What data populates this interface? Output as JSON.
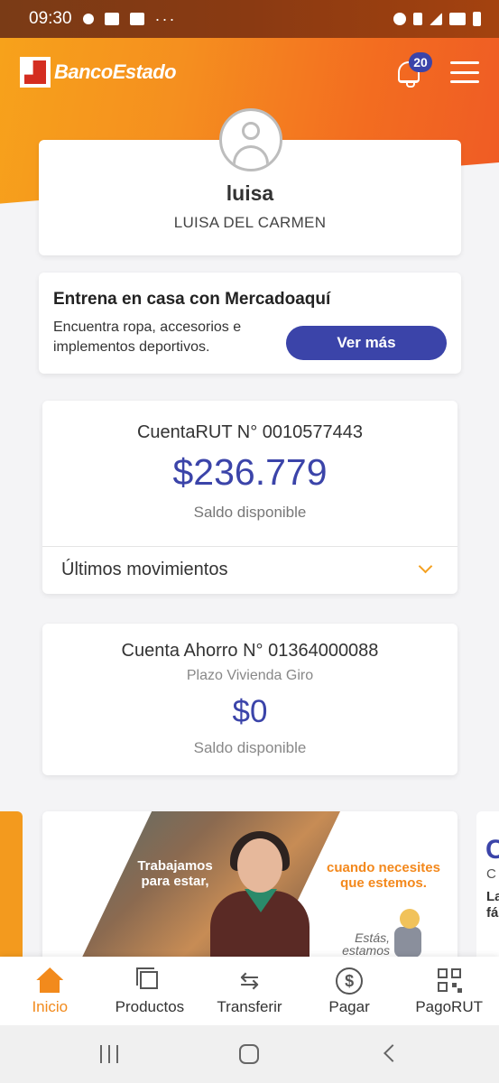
{
  "status_bar": {
    "time": "09:30",
    "left_icons": [
      "music-icon",
      "image-icon",
      "facebook-icon"
    ],
    "more": "···",
    "right_icons": [
      "alarm-icon",
      "data-icon",
      "signal-icon",
      "wifi-icon",
      "battery-icon"
    ]
  },
  "header": {
    "brand": "BancoEstado",
    "notification_count": "20"
  },
  "profile": {
    "nickname": "luisa",
    "full_name": "LUISA DEL CARMEN"
  },
  "promo": {
    "title": "Entrena en casa con Mercadoaquí",
    "description": "Encuentra ropa, accesorios e implementos deportivos.",
    "button_label": "Ver más"
  },
  "accounts": [
    {
      "name": "CuentaRUT N° 0010577443",
      "balance": "$236.779",
      "balance_label": "Saldo disponible",
      "movements_label": "Últimos movimientos"
    },
    {
      "name": "Cuenta Ahorro N° 01364000088",
      "subtitle": "Plazo Vivienda Giro",
      "balance": "$0",
      "balance_label": "Saldo disponible"
    }
  ],
  "banner": {
    "text_left": "Trabajamos para estar,",
    "text_right": "cuando necesites que estemos.",
    "text_bottom": "Estás, estamos"
  },
  "banner_next_peek": {
    "line1": "C",
    "line2": "C",
    "line3": "La fá"
  },
  "bottom_nav": {
    "items": [
      {
        "label": "Inicio",
        "icon": "home-icon",
        "active": true
      },
      {
        "label": "Productos",
        "icon": "products-icon",
        "active": false
      },
      {
        "label": "Transferir",
        "icon": "transfer-icon",
        "active": false
      },
      {
        "label": "Pagar",
        "icon": "pay-icon",
        "active": false
      },
      {
        "label": "PagoRUT",
        "icon": "qr-icon",
        "active": false
      }
    ]
  },
  "colors": {
    "brand_orange": "#f28a1c",
    "brand_blue": "#3b44a9"
  }
}
